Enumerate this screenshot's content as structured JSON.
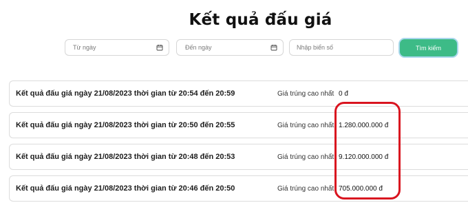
{
  "page": {
    "title": "Kết quả đấu giá"
  },
  "filters": {
    "date_from_placeholder": "Từ ngày",
    "date_to_placeholder": "Đến ngày",
    "plate_placeholder": "Nhập biển số",
    "search_label": "Tìm kiếm"
  },
  "results": [
    {
      "title": "Kết quả đấu giá ngày 21/08/2023 thời gian từ 20:54 đến 20:59",
      "label": "Giá trúng cao nhất",
      "value": "0 đ"
    },
    {
      "title": "Kết quả đấu giá ngày 21/08/2023 thời gian từ 20:50 đến 20:55",
      "label": "Giá trúng cao nhất",
      "value": "1.280.000.000 đ"
    },
    {
      "title": "Kết quả đấu giá ngày 21/08/2023 thời gian từ 20:48 đến 20:53",
      "label": "Giá trúng cao nhất",
      "value": "9.120.000.000 đ"
    },
    {
      "title": "Kết quả đấu giá ngày 21/08/2023 thời gian từ 20:46 đến 20:50",
      "label": "Giá trúng cao nhất",
      "value": "705.000.000 đ"
    }
  ],
  "colors": {
    "search_button": "#3dbb87",
    "search_button_ring": "#a9d7ec",
    "highlight_annotation": "#d9141f"
  },
  "icons": {
    "date_from": "calendar-icon",
    "date_to": "calendar-icon"
  }
}
